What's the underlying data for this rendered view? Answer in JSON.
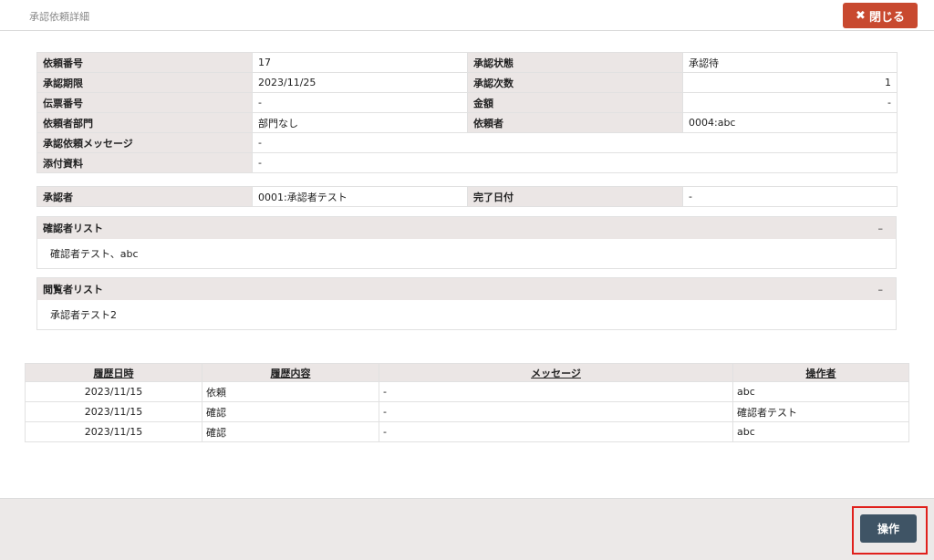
{
  "header": {
    "title": "承認依頼詳細",
    "close_label": "閉じる"
  },
  "info": {
    "request_no_label": "依頼番号",
    "request_no": "17",
    "status_label": "承認状態",
    "status": "承認待",
    "deadline_label": "承認期限",
    "deadline": "2023/11/25",
    "approval_count_label": "承認次数",
    "approval_count": "1",
    "voucher_label": "伝票番号",
    "voucher": "-",
    "amount_label": "金額",
    "amount": "-",
    "dept_label": "依頼者部門",
    "dept": "部門なし",
    "requester_label": "依頼者",
    "requester": "0004:abc",
    "message_label": "承認依頼メッセージ",
    "message": "-",
    "attachment_label": "添付資料",
    "attachment": "-"
  },
  "approver": {
    "approver_label": "承認者",
    "approver": "0001:承認者テスト",
    "complete_date_label": "完了日付",
    "complete_date": "-"
  },
  "confirmers": {
    "title": "確認者リスト",
    "toggle": "–",
    "body": "確認者テスト、abc"
  },
  "viewers": {
    "title": "閲覧者リスト",
    "toggle": "–",
    "body": "承認者テスト2"
  },
  "history": {
    "columns": [
      "履歴日時",
      "履歴内容",
      "メッセージ",
      "操作者"
    ],
    "rows": [
      [
        "2023/11/15",
        "依頼",
        "-",
        "abc"
      ],
      [
        "2023/11/15",
        "確認",
        "-",
        "確認者テスト"
      ],
      [
        "2023/11/15",
        "確認",
        "-",
        "abc"
      ]
    ]
  },
  "footer": {
    "action_label": "操作"
  },
  "colors": {
    "close_button": "#c8492f",
    "action_button": "#3f5465",
    "highlight": "#e0201c",
    "label_bg": "#ebe6e5"
  }
}
